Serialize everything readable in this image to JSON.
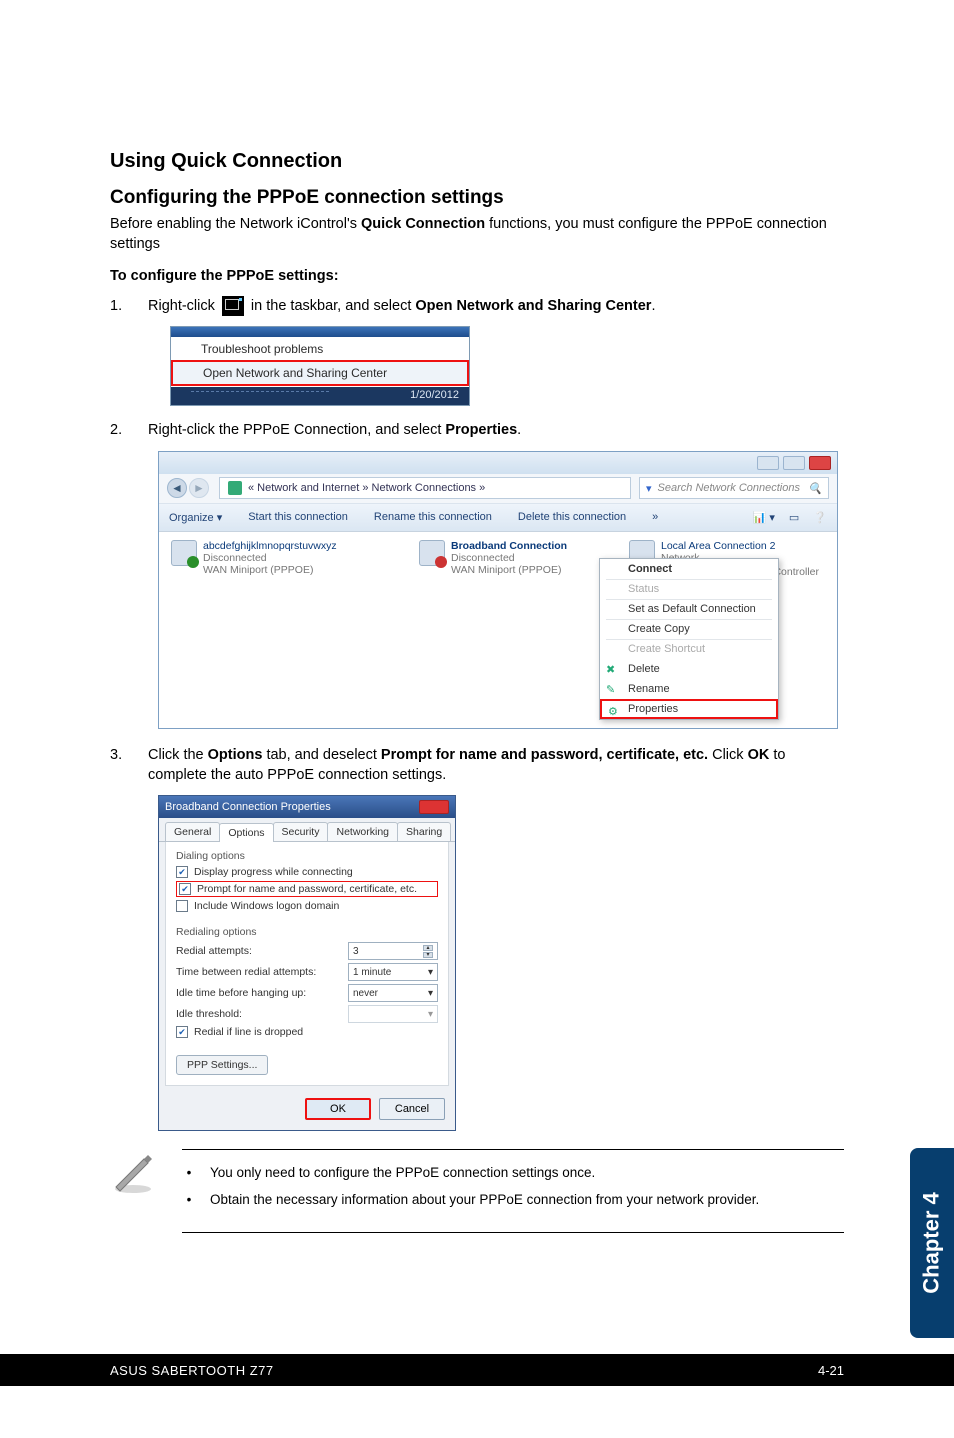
{
  "headings": {
    "quick": "Using Quick Connection",
    "config": "Configuring the PPPoE connection settings"
  },
  "paras": {
    "intro_a": "Before enabling the Network iControl's ",
    "intro_b": "Quick Connection",
    "intro_c": " functions, you must configure the PPPoE connection settings",
    "toconfig": "To configure the PPPoE settings",
    "colon": ":"
  },
  "steps": {
    "s1": {
      "num": "1.",
      "a": "Right-click ",
      "b": " in the taskbar, and select ",
      "bold": "Open Network and Sharing Center",
      "c": "."
    },
    "s2": {
      "num": "2.",
      "a": "Right-click the PPPoE Connection, and select ",
      "bold": "Properties",
      "b": "."
    },
    "s3": {
      "num": "3.",
      "a": "Click the ",
      "b1": "Options",
      "c": " tab, and deselect ",
      "b2": "Prompt for name and password, certificate, etc.",
      "d": " Click ",
      "b3": "OK",
      "e": " to complete the auto PPPoE connection settings."
    }
  },
  "shot1": {
    "item1": "Troubleshoot problems",
    "item2": "Open Network and Sharing Center",
    "date": "1/20/2012"
  },
  "shot2": {
    "breadcrumb": "« Network and Internet » Network Connections »",
    "search": "Search Network Connections",
    "toolbar": {
      "organize": "Organize ▾",
      "start": "Start this connection",
      "rename": "Rename this connection",
      "delete": "Delete this connection",
      "more": "»"
    },
    "conn1": {
      "t1": "abcdefghijklmnopqrstuvwxyz",
      "t2": "Disconnected",
      "t3": "WAN Miniport (PPPOE)"
    },
    "conn2": {
      "t1": "Broadband Connection",
      "t2": "Disconnected",
      "t3": "WAN Miniport (PPPOE)"
    },
    "conn3": {
      "t1": "Local Area Connection 2",
      "t2": "Network"
    },
    "ctx": {
      "connect": "Connect",
      "status": "Status",
      "setdefault": "Set as Default Connection",
      "createcopy": "Create Copy",
      "createshortcut": "Create Shortcut",
      "delete": "Delete",
      "rename": "Rename",
      "properties": "Properties"
    },
    "controller": "My Controller"
  },
  "shot3": {
    "title": "Broadband Connection Properties",
    "tabs": {
      "general": "General",
      "options": "Options",
      "security": "Security",
      "networking": "Networking",
      "sharing": "Sharing"
    },
    "grp1": "Dialing options",
    "chk1": "Display progress while connecting",
    "chk2": "Prompt for name and password, certificate, etc.",
    "chk3": "Include Windows logon domain",
    "grp2": "Redialing options",
    "r1": "Redial attempts:",
    "r2": "Time between redial attempts:",
    "r3": "Idle time before hanging up:",
    "r4": "Idle threshold:",
    "r5": "Redial if line is dropped",
    "v1": "3",
    "v2": "1 minute",
    "v3": "never",
    "ppp": "PPP Settings...",
    "ok": "OK",
    "cancel": "Cancel"
  },
  "notes": {
    "n1": "You only need to configure the PPPoE connection settings once.",
    "n2": "Obtain the necessary information about your PPPoE connection from your network provider."
  },
  "sidetab": "Chapter 4",
  "footer": {
    "prod": "ASUS SABERTOOTH Z77",
    "page": "4-21"
  }
}
